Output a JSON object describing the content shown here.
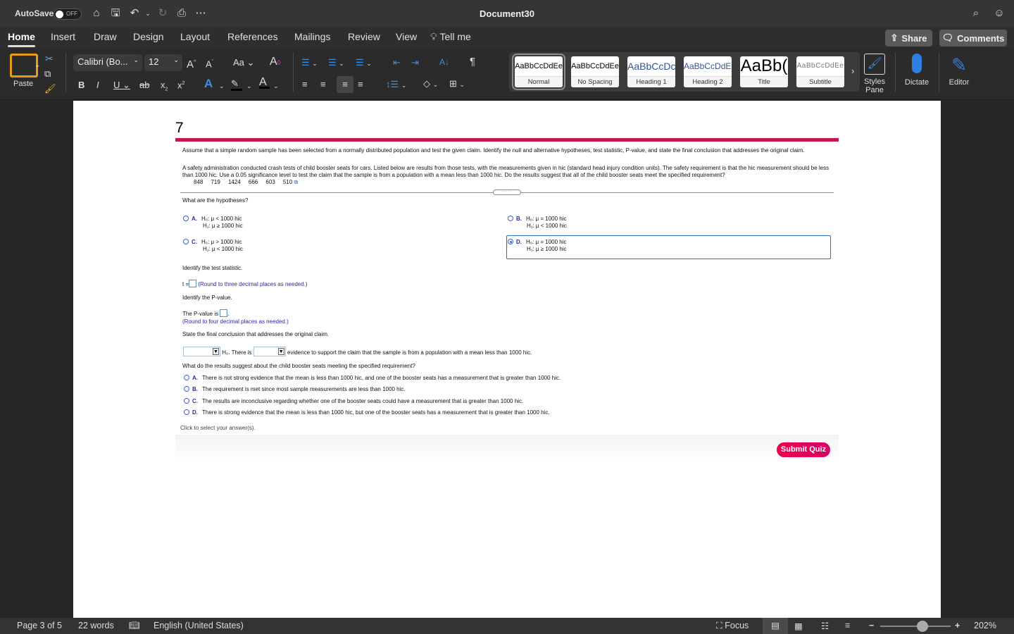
{
  "titlebar": {
    "autosave_label": "AutoSave",
    "autosave_state": "OFF",
    "document_title": "Document30"
  },
  "tabs": [
    "Home",
    "Insert",
    "Draw",
    "Design",
    "Layout",
    "References",
    "Mailings",
    "Review",
    "View",
    "Tell me"
  ],
  "active_tab": "Home",
  "top_buttons": {
    "share": "Share",
    "comments": "Comments"
  },
  "ribbon": {
    "paste_label": "Paste",
    "font_name": "Calibri (Bo...",
    "font_size": "12",
    "change_case": "Aa",
    "styles": [
      {
        "preview": "AaBbCcDdEe",
        "name": "Normal",
        "selected": true
      },
      {
        "preview": "AaBbCcDdEe",
        "name": "No Spacing"
      },
      {
        "preview": "AaBbCcDc",
        "name": "Heading 1"
      },
      {
        "preview": "AaBbCcDdEe",
        "name": "Heading 2"
      },
      {
        "preview": "AaBb(",
        "name": "Title"
      },
      {
        "preview": "AaBbCcDdEe",
        "name": "Subtitle"
      }
    ],
    "styles_pane": "Styles Pane",
    "dictate": "Dictate",
    "editor": "Editor"
  },
  "document": {
    "question_number": "7",
    "intro": "Assume that a simple random sample has been selected from a normally distributed population and test the given claim. Identify the null and alternative hypotheses, test statistic, P-value, and state the final conclusion that addresses the original claim.",
    "scenario": "A safety administration conducted crash tests of child booster seats for cars. Listed below are results from those tests, with the measurements given in hic (standard head injury condition units). The safety requirement is that the hic measurement should be less than 1000 hic. Use a 0.05 significance level to test the claim that the sample is from a population with a mean less than 1000 hic. Do the results suggest that all of the child booster seats meet the specified requirement?",
    "data_values": [
      "848",
      "719",
      "1424",
      "666",
      "603",
      "510"
    ],
    "hypotheses_prompt": "What are the hypotheses?",
    "hypotheses_options": [
      {
        "letter": "A.",
        "h0": "H₀: μ < 1000 hic",
        "h1": "H₁: μ ≥ 1000 hic",
        "selected": false
      },
      {
        "letter": "B.",
        "h0": "H₀: μ = 1000 hic",
        "h1": "H₁: μ < 1000 hic",
        "selected": false
      },
      {
        "letter": "C.",
        "h0": "H₀: μ > 1000 hic",
        "h1": "H₁: μ < 1000 hic",
        "selected": false
      },
      {
        "letter": "D.",
        "h0": "H₀: μ = 1000 hic",
        "h1": "H₁: μ ≥ 1000 hic",
        "selected": true
      }
    ],
    "test_stat_prompt": "Identify the test statistic.",
    "t_label": "t =",
    "t_value": "",
    "t_hint": "(Round to three decimal places as needed.)",
    "pvalue_prompt": "Identify the P-value.",
    "pvalue_label": "The P-value is",
    "pvalue_value": "",
    "pvalue_hint": "(Round to four decimal places as needed.)",
    "conclusion_prompt": "State the final conclusion that addresses the original claim.",
    "conclusion_mid": "H₀. There is",
    "conclusion_end": "evidence to support the claim that the sample is from a population with a mean less than 1000 hic.",
    "dropdown1_value": "",
    "dropdown2_value": "",
    "results_prompt": "What do the results suggest about the child booster seats meeting the specified requirement?",
    "results_options": [
      {
        "letter": "A.",
        "text": "There is not strong evidence that the mean is less than 1000 hic, and one of the booster seats has a measurement that is greater than 1000 hic."
      },
      {
        "letter": "B.",
        "text": "The requirement is met since most sample measurements are less than 1000 hic."
      },
      {
        "letter": "C.",
        "text": "The results are inconclusive regarding whether one of the booster seats could have a measurement that is greater than 1000 hic."
      },
      {
        "letter": "D.",
        "text": "There is strong evidence that the mean is less than 1000 hic, but one of the booster seats has a measurement that is greater than 1000 hic."
      }
    ],
    "click_hint": "Click to select your answer(s).",
    "submit_label": "Submit Quiz"
  },
  "statusbar": {
    "page": "Page 3 of 5",
    "words": "22 words",
    "language": "English (United States)",
    "focus": "Focus",
    "zoom": "202%"
  },
  "colors": {
    "accent_red": "#c5184a",
    "submit": "#f0004a",
    "link_blue": "#2a2aa0"
  }
}
